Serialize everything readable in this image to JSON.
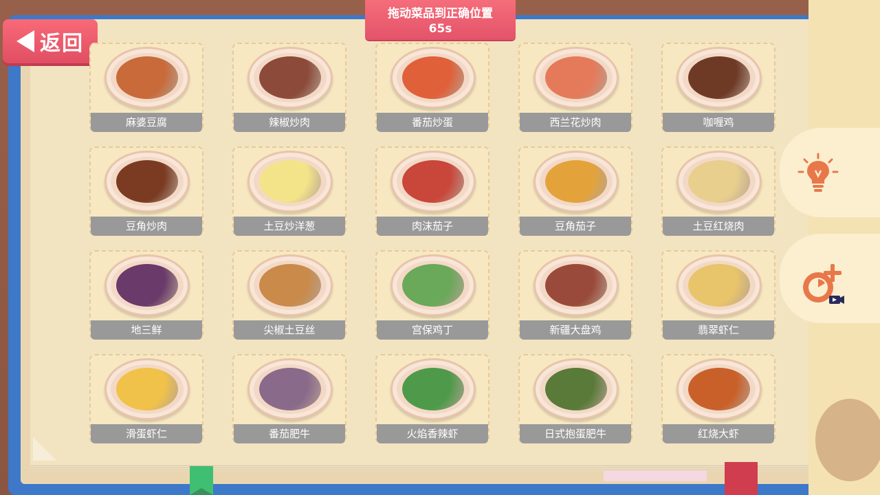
{
  "banner": {
    "title": "拖动菜品到正确位置",
    "timer": "65s"
  },
  "back_button": {
    "label": "返回"
  },
  "colors": {
    "banner": "#e4536a",
    "card_label_bg": "#999999",
    "tool_icon": "#e8784a"
  },
  "tools": {
    "hint_icon": "lightbulb-icon",
    "add_time_icon": "add-time-video-icon"
  },
  "dishes": [
    {
      "name": "麻婆豆腐",
      "food": "#c86a3a"
    },
    {
      "name": "辣椒炒肉",
      "food": "#8b4a3a"
    },
    {
      "name": "番茄炒蛋",
      "food": "#e0603a"
    },
    {
      "name": "西兰花炒肉",
      "food": "#e57a5a"
    },
    {
      "name": "咖喱鸡",
      "food": "#6e3a26"
    },
    {
      "name": "豆角炒肉",
      "food": "#7a3b22"
    },
    {
      "name": "土豆炒洋葱",
      "food": "#f3e48a"
    },
    {
      "name": "肉沫茄子",
      "food": "#c9463a"
    },
    {
      "name": "豆角茄子",
      "food": "#e4a33a"
    },
    {
      "name": "土豆红烧肉",
      "food": "#e8cf8e"
    },
    {
      "name": "地三鲜",
      "food": "#6a3a6a"
    },
    {
      "name": "尖椒土豆丝",
      "food": "#c98a4a"
    },
    {
      "name": "宫保鸡丁",
      "food": "#6aa85a"
    },
    {
      "name": "新疆大盘鸡",
      "food": "#9a4a3a"
    },
    {
      "name": "翡翠虾仁",
      "food": "#e8c46a"
    },
    {
      "name": "滑蛋虾仁",
      "food": "#f0c24a"
    },
    {
      "name": "番茄肥牛",
      "food": "#8a6a8a"
    },
    {
      "name": "火焰香辣虾",
      "food": "#4f9a4a"
    },
    {
      "name": "日式抱蛋肥牛",
      "food": "#5a7a3a"
    },
    {
      "name": "红烧大虾",
      "food": "#c9602a"
    }
  ]
}
